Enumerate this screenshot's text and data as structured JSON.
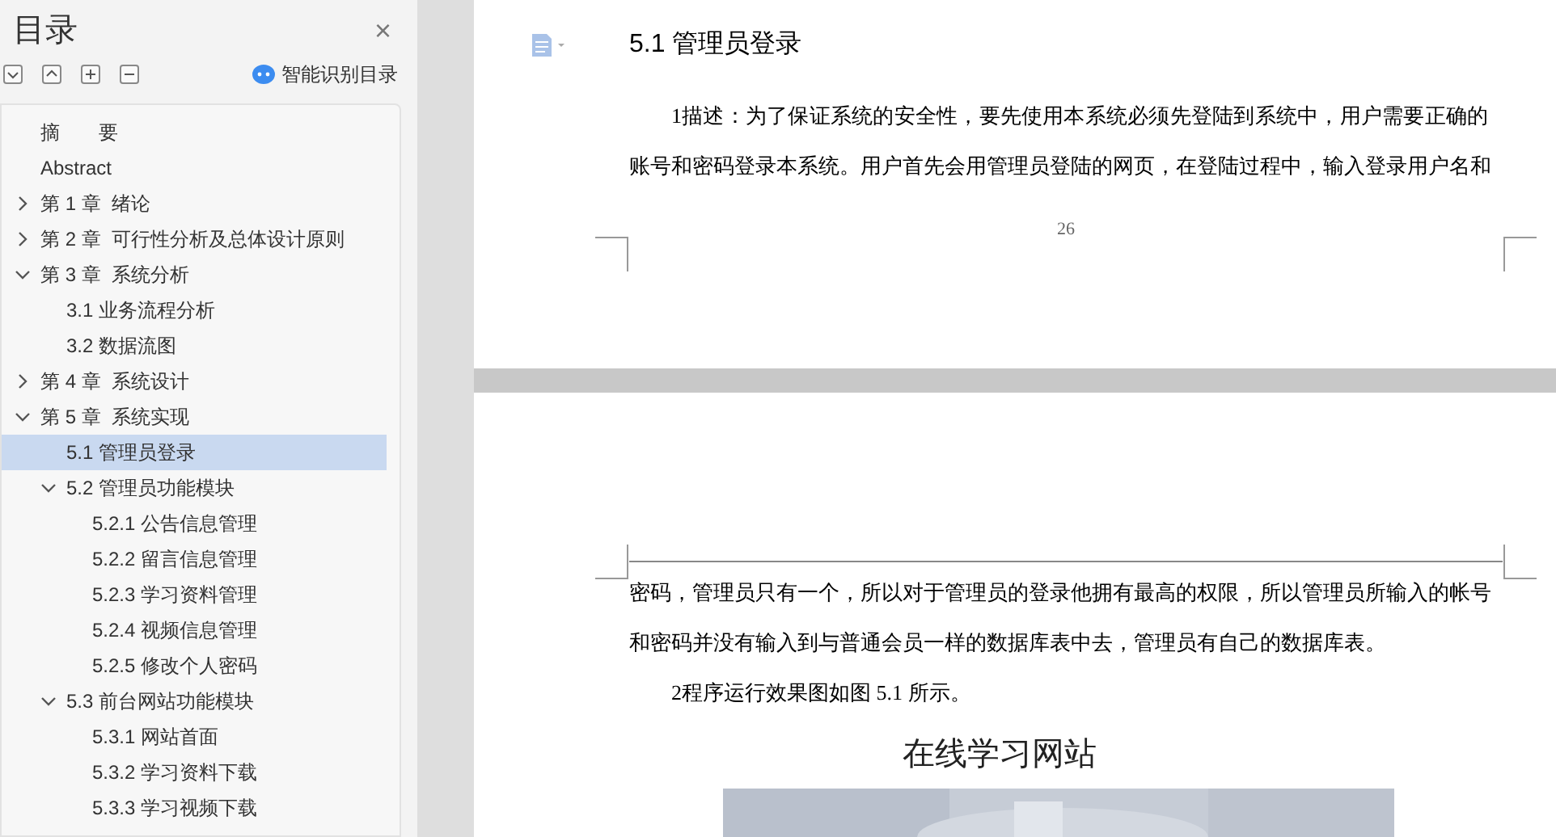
{
  "sidebar": {
    "title": "目录",
    "close": "×",
    "smart_button": "智能识别目录",
    "toc": [
      {
        "label": "摘　　要",
        "selected": false
      },
      {
        "label": "Abstract",
        "selected": false
      },
      {
        "label": "第 1 章  绪论",
        "expanded": false,
        "selected": false
      },
      {
        "label": "第 2 章  可行性分析及总体设计原则",
        "expanded": false,
        "selected": false
      },
      {
        "label": "第 3 章  系统分析",
        "expanded": true,
        "selected": false,
        "children": [
          {
            "label": "3.1 业务流程分析",
            "selected": false
          },
          {
            "label": "3.2 数据流图",
            "selected": false
          }
        ]
      },
      {
        "label": "第 4 章  系统设计",
        "expanded": false,
        "selected": false
      },
      {
        "label": "第 5 章  系统实现",
        "expanded": true,
        "selected": false,
        "children": [
          {
            "label": "5.1 管理员登录",
            "selected": true
          },
          {
            "label": "5.2 管理员功能模块",
            "expanded": true,
            "selected": false,
            "children": [
              {
                "label": "5.2.1 公告信息管理",
                "selected": false
              },
              {
                "label": "5.2.2 留言信息管理",
                "selected": false
              },
              {
                "label": "5.2.3 学习资料管理",
                "selected": false
              },
              {
                "label": "5.2.4 视频信息管理",
                "selected": false
              },
              {
                "label": "5.2.5 修改个人密码",
                "selected": false
              }
            ]
          },
          {
            "label": "5.3 前台网站功能模块",
            "expanded": true,
            "selected": false,
            "children": [
              {
                "label": "5.3.1 网站首面",
                "selected": false
              },
              {
                "label": "5.3.2 学习资料下载",
                "selected": false
              },
              {
                "label": "5.3.3 学习视频下载",
                "selected": false
              }
            ]
          }
        ]
      }
    ]
  },
  "document": {
    "heading": "5.1 管理员登录",
    "page1_paragraphs": [
      {
        "continued": false,
        "lines": [
          "1描述：为了保证系统的安全性，要先使用本系统必须先登陆到系统中，用户需要正确的",
          "账号和密码登录本系统。用户首先会用管理员登陆的网页，在登陆过程中，输入登录用户名和"
        ]
      }
    ],
    "page_number": "26",
    "page2_paragraphs": [
      {
        "continued": true,
        "lines": [
          "密码，管理员只有一个，所以对于管理员的登录他拥有最高的权限，所以管理员所输入的帐号",
          "和密码并没有输入到与普通会员一样的数据库表中去，管理员有自己的数据库表。"
        ]
      },
      {
        "continued": false,
        "lines": [
          "2程序运行效果图如图 5.1 所示。"
        ]
      }
    ],
    "figure_title": "在线学习网站"
  }
}
